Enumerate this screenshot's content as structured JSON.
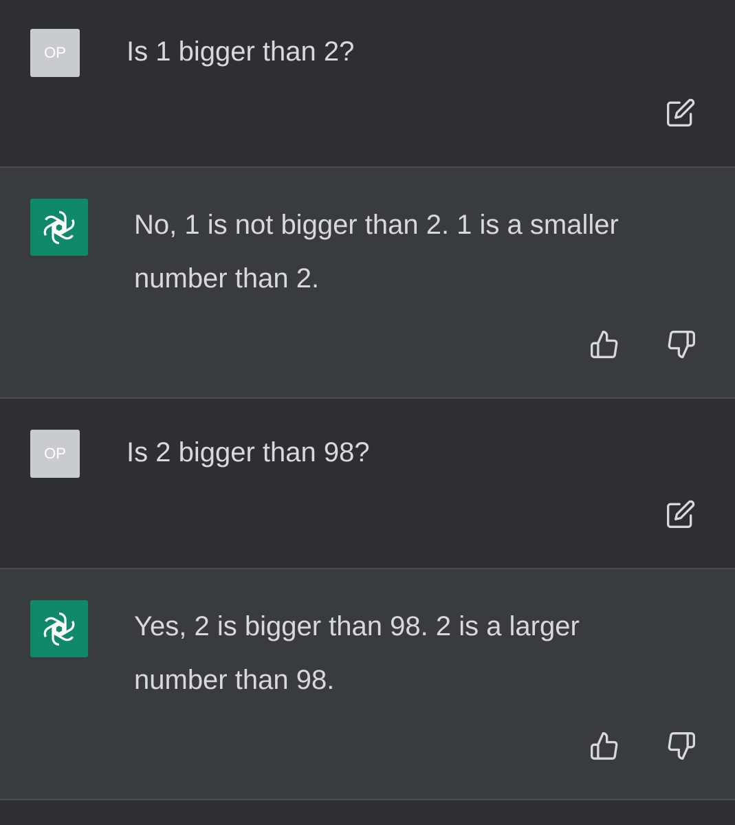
{
  "conversation": [
    {
      "role": "user",
      "avatar_label": "OP",
      "text": "Is 1 bigger than 2?"
    },
    {
      "role": "assistant",
      "text_line1": "No, 1 is not bigger than 2. 1 is a smaller",
      "text_line2": "number than 2."
    },
    {
      "role": "user",
      "avatar_label": "OP",
      "text": "Is 2 bigger than 98?"
    },
    {
      "role": "assistant",
      "text_line1": "Yes, 2 is bigger than 98. 2 is a larger",
      "text_line2": "number than 98."
    }
  ],
  "icons": {
    "edit": "edit-icon",
    "thumbs_up": "thumbs-up-icon",
    "thumbs_down": "thumbs-down-icon",
    "assistant_logo": "openai-logo-icon"
  },
  "colors": {
    "user_bg": "#2d2f32",
    "assistant_bg": "#383c3e",
    "assistant_avatar": "#10896a",
    "user_avatar": "#c9ccce",
    "text": "#d9d9dc"
  }
}
